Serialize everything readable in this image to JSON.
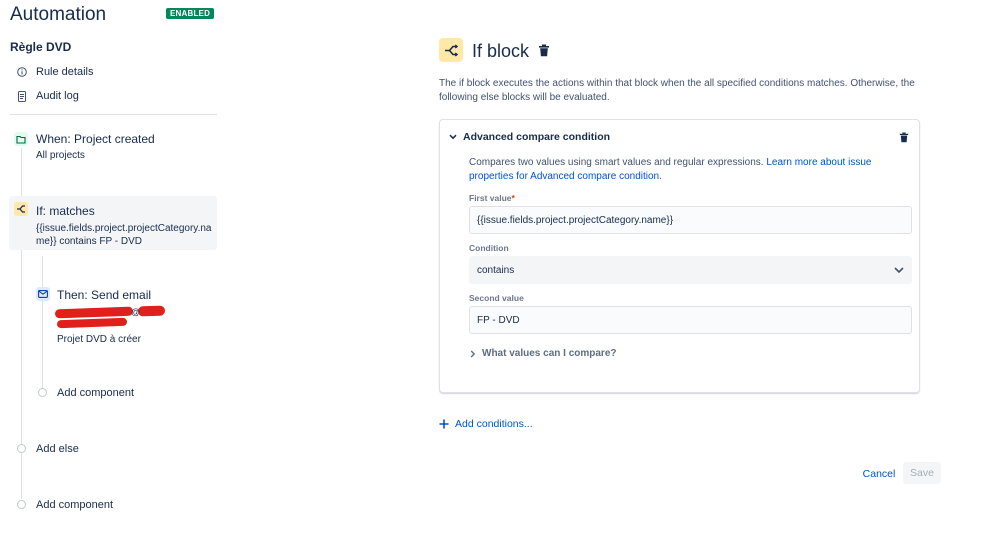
{
  "app": {
    "title": "Automation",
    "status_badge": "ENABLED"
  },
  "sidebar": {
    "rule_name": "Règle DVD",
    "links": [
      {
        "label": "Rule details",
        "icon": "info-icon"
      },
      {
        "label": "Audit log",
        "icon": "document-icon"
      }
    ]
  },
  "flow": {
    "trigger": {
      "title": "When: Project created",
      "subtitle": "All projects",
      "icon": "trigger-icon"
    },
    "condition": {
      "title": "If: matches",
      "subtitle_line1": "{{issue.fields.project.projectCategory.na",
      "subtitle_line2": "me}} contains FP - DVD",
      "icon": "branch-icon"
    },
    "action": {
      "title": "Then: Send email",
      "email_domain_glyph": "@",
      "subtitle": "Projet DVD à créer",
      "icon": "email-icon"
    },
    "add_component_inner": "Add component",
    "add_else": "Add else",
    "add_component_outer": "Add component"
  },
  "panel": {
    "title": "If block",
    "description": "The if block executes the actions within that block when the all specified conditions matches. Otherwise, the following else blocks will be evaluated.",
    "condition": {
      "header": "Advanced compare condition",
      "description": "Compares two values using smart values and regular expressions.",
      "learn_more_link": "Learn more about issue properties for Advanced compare condition",
      "description_end": ".",
      "first_value_label": "First value",
      "required_mark": "*",
      "first_value": "{{issue.fields.project.projectCategory.name}}",
      "condition_label": "Condition",
      "condition_value": "contains",
      "second_value_label": "Second value",
      "second_value": "FP - DVD",
      "what_values_link": "What values can I compare?"
    },
    "add_conditions": "Add conditions...",
    "cancel_button": "Cancel",
    "save_button": "Save"
  },
  "colors": {
    "enabled_badge": "#00875a",
    "link_blue": "#0052cc",
    "branch_icon_bg": "#ffe8a8",
    "trigger_icon_bg": "#e3fcef",
    "email_icon_bg": "#deebff",
    "redaction": "#e0201b"
  }
}
